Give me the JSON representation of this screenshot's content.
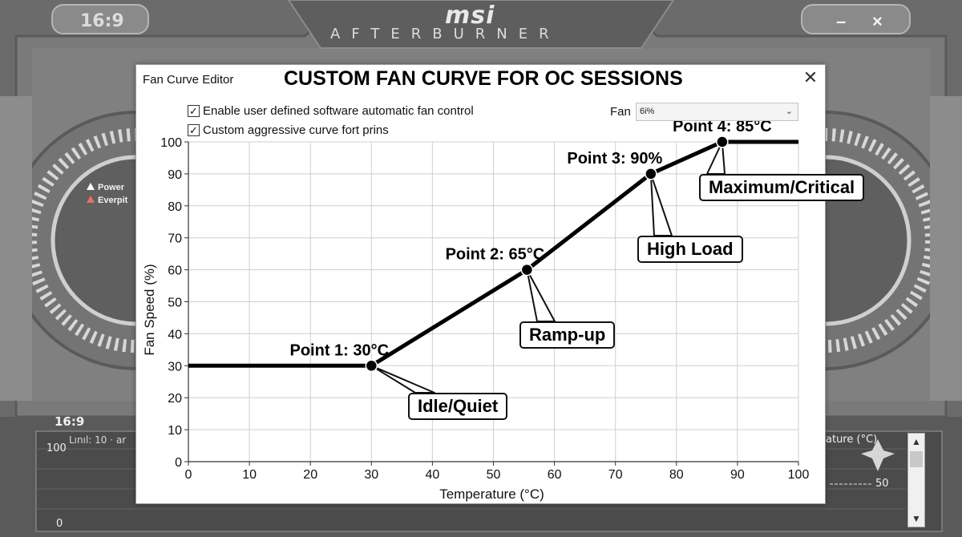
{
  "app": {
    "ratio_top": "16:9",
    "brand": "msi",
    "product": "AFTERBURNER",
    "minimize": "–",
    "close": "×",
    "ratio_bottom": "16:9",
    "bottom_scale_top": "100",
    "bottom_scale_bottom": "0",
    "bottom_scale_right": "50",
    "link_text": "Lınıl: 10 · ar",
    "temperature_label": "ature (°C)",
    "legend": [
      {
        "label": "Power",
        "color": "#ffffff"
      },
      {
        "label": "Everpit",
        "color": "#e96f63"
      }
    ],
    "scroll_up": "▲",
    "scroll_down": "▼"
  },
  "dialog": {
    "title": "Fan Curve Editor",
    "close": "✕",
    "checkboxes": [
      {
        "label": "Enable user defined software automatic fan control",
        "checked": true,
        "mark": "✓"
      },
      {
        "label": "Custom aggressive curve fort prins",
        "checked": true,
        "mark": "✓"
      }
    ],
    "fan_label": "Fan",
    "fan_value": "6i%",
    "fan_chevron": "⌄"
  },
  "chart_data": {
    "type": "line",
    "title": "CUSTOM FAN CURVE FOR OC SESSIONS",
    "xlabel": "Temperature (°C)",
    "ylabel": "Fan Speed (%)",
    "xlim": [
      0,
      100
    ],
    "ylim": [
      0,
      100
    ],
    "xticks": [
      0,
      10,
      20,
      30,
      40,
      50,
      60,
      70,
      80,
      90,
      100
    ],
    "yticks": [
      0,
      10,
      20,
      30,
      40,
      50,
      60,
      70,
      80,
      90,
      100
    ],
    "grid": true,
    "series": [
      {
        "x": [
          0,
          30,
          55.5,
          75.8,
          87.5,
          100
        ],
        "y": [
          30,
          30,
          60,
          90,
          100,
          100
        ],
        "color": "#000000"
      }
    ],
    "points": [
      {
        "x": 30,
        "y": 30,
        "label": "Point 1: 30°C"
      },
      {
        "x": 55.5,
        "y": 60,
        "label": "Point 2: 65°C"
      },
      {
        "x": 75.8,
        "y": 90,
        "label": "Point 3: 90%"
      },
      {
        "x": 87.5,
        "y": 100,
        "label": "Point 4: 85°C"
      }
    ],
    "callouts": [
      "Idle/Quiet",
      "Ramp-up",
      "High Load",
      "Maximum/Critical"
    ]
  }
}
